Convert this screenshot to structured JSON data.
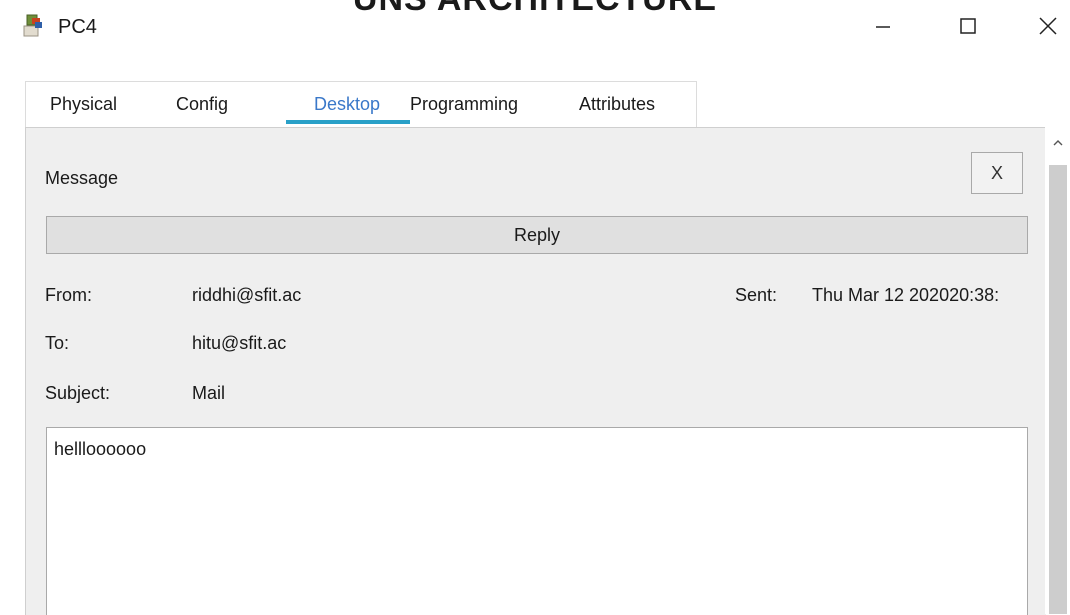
{
  "overlay_heading": "UNS ARCHITECTURE",
  "window": {
    "title": "PC4",
    "icon": "pc-device-icon",
    "controls": {
      "minimize_icon": "minimize-icon",
      "maximize_icon": "maximize-icon",
      "close_icon": "close-icon"
    }
  },
  "tabs": [
    {
      "label": "Physical",
      "active": false
    },
    {
      "label": "Config",
      "active": false
    },
    {
      "label": "Desktop",
      "active": true
    },
    {
      "label": "Programming",
      "active": false
    },
    {
      "label": "Attributes",
      "active": false
    }
  ],
  "message": {
    "title": "Message",
    "close_label": "X",
    "reply_label": "Reply",
    "from_label": "From:",
    "from_value": "riddhi@sfit.ac",
    "sent_label": "Sent:",
    "sent_value": "Thu Mar 12 202020:38:",
    "to_label": "To:",
    "to_value": "hitu@sfit.ac",
    "subject_label": "Subject:",
    "subject_value": "Mail",
    "body": "hellloooooo"
  },
  "colors": {
    "accent_tab": "#3a78c9",
    "tab_underline": "#29a0c8",
    "panel_bg": "#efefef"
  }
}
